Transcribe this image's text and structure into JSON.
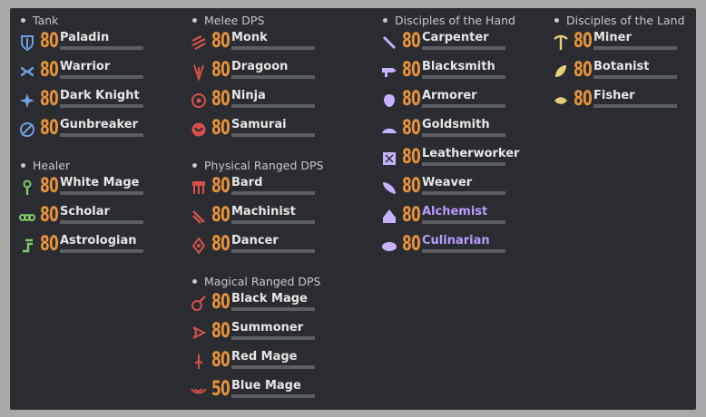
{
  "groups": [
    {
      "title": "Tank",
      "jobs": [
        {
          "name": "Paladin",
          "level": "80",
          "icon": "paladin-icon"
        },
        {
          "name": "Warrior",
          "level": "80",
          "icon": "warrior-icon"
        },
        {
          "name": "Dark Knight",
          "level": "80",
          "icon": "dark-knight-icon"
        },
        {
          "name": "Gunbreaker",
          "level": "80",
          "icon": "gunbreaker-icon"
        }
      ]
    },
    {
      "title": "Healer",
      "jobs": [
        {
          "name": "White Mage",
          "level": "80",
          "icon": "white-mage-icon"
        },
        {
          "name": "Scholar",
          "level": "80",
          "icon": "scholar-icon"
        },
        {
          "name": "Astrologian",
          "level": "80",
          "icon": "astrologian-icon"
        }
      ]
    },
    {
      "title": "Melee DPS",
      "jobs": [
        {
          "name": "Monk",
          "level": "80",
          "icon": "monk-icon"
        },
        {
          "name": "Dragoon",
          "level": "80",
          "icon": "dragoon-icon"
        },
        {
          "name": "Ninja",
          "level": "80",
          "icon": "ninja-icon"
        },
        {
          "name": "Samurai",
          "level": "80",
          "icon": "samurai-icon"
        }
      ]
    },
    {
      "title": "Physical Ranged DPS",
      "jobs": [
        {
          "name": "Bard",
          "level": "80",
          "icon": "bard-icon"
        },
        {
          "name": "Machinist",
          "level": "80",
          "icon": "machinist-icon"
        },
        {
          "name": "Dancer",
          "level": "80",
          "icon": "dancer-icon"
        }
      ]
    },
    {
      "title": "Magical Ranged DPS",
      "jobs": [
        {
          "name": "Black Mage",
          "level": "80",
          "icon": "black-mage-icon"
        },
        {
          "name": "Summoner",
          "level": "80",
          "icon": "summoner-icon"
        },
        {
          "name": "Red Mage",
          "level": "80",
          "icon": "red-mage-icon"
        },
        {
          "name": "Blue Mage",
          "level": "50",
          "icon": "blue-mage-icon"
        }
      ]
    },
    {
      "title": "Disciples of the Hand",
      "jobs": [
        {
          "name": "Carpenter",
          "level": "80",
          "icon": "carpenter-icon"
        },
        {
          "name": "Blacksmith",
          "level": "80",
          "icon": "blacksmith-icon"
        },
        {
          "name": "Armorer",
          "level": "80",
          "icon": "armorer-icon"
        },
        {
          "name": "Goldsmith",
          "level": "80",
          "icon": "goldsmith-icon"
        },
        {
          "name": "Leatherworker",
          "level": "80",
          "icon": "leatherworker-icon"
        },
        {
          "name": "Weaver",
          "level": "80",
          "icon": "weaver-icon"
        },
        {
          "name": "Alchemist",
          "level": "80",
          "icon": "alchemist-icon",
          "highlight": true
        },
        {
          "name": "Culinarian",
          "level": "80",
          "icon": "culinarian-icon",
          "highlight": true
        }
      ]
    },
    {
      "title": "Disciples of the Land",
      "jobs": [
        {
          "name": "Miner",
          "level": "80",
          "icon": "miner-icon"
        },
        {
          "name": "Botanist",
          "level": "80",
          "icon": "botanist-icon"
        },
        {
          "name": "Fisher",
          "level": "80",
          "icon": "fisher-icon"
        }
      ]
    }
  ],
  "colors": {
    "tank": "#6fa0e0",
    "healer": "#7fcf6a",
    "dps": "#d8504a",
    "crafter": "#c8b2ff",
    "gatherer": "#e6cf7a",
    "level": "#e8923a"
  }
}
